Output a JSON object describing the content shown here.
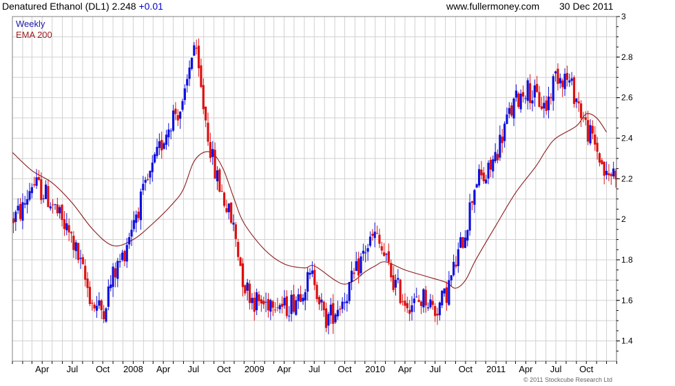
{
  "header": {
    "title": "Denatured Ethanol (DL1) 2.248",
    "change": "+0.01",
    "site": "www.fullermoney.com",
    "date": "30 Dec 2011"
  },
  "legend": {
    "weekly": "Weekly",
    "ema": "EMA 200"
  },
  "copyright": "© 2011 Stockcube Research Ltd",
  "colors": {
    "up": "#1010dd",
    "down": "#dd1010",
    "ema": "#8b1a1a",
    "grid": "#d0d0d0",
    "frame": "#808080"
  },
  "chart_data": {
    "type": "candlestick",
    "frequency": "weekly",
    "x_range": [
      "2007-01",
      "2011-12"
    ],
    "ylim": [
      1.3,
      3.0
    ],
    "yticks": [
      1.4,
      1.6,
      1.8,
      2,
      2.2,
      2.4,
      2.6,
      2.8,
      3
    ],
    "ytick_labels": [
      "1.4",
      "1.6",
      "1.8",
      "2",
      "2.2",
      "2.4",
      "2.6",
      "2.8",
      "3"
    ],
    "xticks": [
      {
        "label": "Apr",
        "date": "2007-04"
      },
      {
        "label": "Jul",
        "date": "2007-07"
      },
      {
        "label": "Oct",
        "date": "2007-10"
      },
      {
        "label": "2008",
        "date": "2008-01"
      },
      {
        "label": "Apr",
        "date": "2008-04"
      },
      {
        "label": "Jul",
        "date": "2008-07"
      },
      {
        "label": "Oct",
        "date": "2008-10"
      },
      {
        "label": "2009",
        "date": "2009-01"
      },
      {
        "label": "Apr",
        "date": "2009-04"
      },
      {
        "label": "Jul",
        "date": "2009-07"
      },
      {
        "label": "Oct",
        "date": "2009-10"
      },
      {
        "label": "2010",
        "date": "2010-01"
      },
      {
        "label": "Apr",
        "date": "2010-04"
      },
      {
        "label": "Jul",
        "date": "2010-07"
      },
      {
        "label": "Oct",
        "date": "2010-10"
      },
      {
        "label": "2011",
        "date": "2011-01"
      },
      {
        "label": "Apr",
        "date": "2011-04"
      },
      {
        "label": "Jul",
        "date": "2011-07"
      },
      {
        "label": "Oct",
        "date": "2011-10"
      }
    ],
    "price_path": [
      [
        "2007-01",
        2.0
      ],
      [
        "2007-02",
        2.05
      ],
      [
        "2007-03",
        2.18
      ],
      [
        "2007-04",
        2.14
      ],
      [
        "2007-05",
        2.08
      ],
      [
        "2007-06",
        1.98
      ],
      [
        "2007-07",
        1.9
      ],
      [
        "2007-08",
        1.74
      ],
      [
        "2007-09",
        1.58
      ],
      [
        "2007-10",
        1.55
      ],
      [
        "2007-11",
        1.72
      ],
      [
        "2007-12",
        1.82
      ],
      [
        "2008-01",
        2.0
      ],
      [
        "2008-02",
        2.12
      ],
      [
        "2008-03",
        2.25
      ],
      [
        "2008-04",
        2.4
      ],
      [
        "2008-05",
        2.52
      ],
      [
        "2008-06",
        2.55
      ],
      [
        "2008-07",
        2.88
      ],
      [
        "2008-08",
        2.55
      ],
      [
        "2008-09",
        2.25
      ],
      [
        "2008-10",
        2.1
      ],
      [
        "2008-11",
        1.95
      ],
      [
        "2008-12",
        1.68
      ],
      [
        "2009-01",
        1.6
      ],
      [
        "2009-02",
        1.58
      ],
      [
        "2009-03",
        1.62
      ],
      [
        "2009-04",
        1.56
      ],
      [
        "2009-05",
        1.6
      ],
      [
        "2009-06",
        1.68
      ],
      [
        "2009-07",
        1.72
      ],
      [
        "2009-08",
        1.5
      ],
      [
        "2009-09",
        1.55
      ],
      [
        "2009-10",
        1.62
      ],
      [
        "2009-11",
        1.72
      ],
      [
        "2009-12",
        1.85
      ],
      [
        "2010-01",
        1.92
      ],
      [
        "2010-02",
        1.8
      ],
      [
        "2010-03",
        1.68
      ],
      [
        "2010-04",
        1.6
      ],
      [
        "2010-05",
        1.58
      ],
      [
        "2010-06",
        1.62
      ],
      [
        "2010-07",
        1.55
      ],
      [
        "2010-08",
        1.62
      ],
      [
        "2010-09",
        1.78
      ],
      [
        "2010-10",
        1.95
      ],
      [
        "2010-11",
        2.2
      ],
      [
        "2010-12",
        2.2
      ],
      [
        "2011-01",
        2.32
      ],
      [
        "2011-02",
        2.48
      ],
      [
        "2011-03",
        2.58
      ],
      [
        "2011-04",
        2.65
      ],
      [
        "2011-05",
        2.6
      ],
      [
        "2011-06",
        2.55
      ],
      [
        "2011-07",
        2.72
      ],
      [
        "2011-08",
        2.7
      ],
      [
        "2011-09",
        2.6
      ],
      [
        "2011-10",
        2.45
      ],
      [
        "2011-11",
        2.35
      ],
      [
        "2011-12",
        2.2
      ],
      [
        "2011-12-30",
        2.248
      ]
    ],
    "ema_200": [
      [
        "2007-01",
        2.33
      ],
      [
        "2007-03",
        2.24
      ],
      [
        "2007-05",
        2.18
      ],
      [
        "2007-07",
        2.08
      ],
      [
        "2007-09",
        1.95
      ],
      [
        "2007-11",
        1.87
      ],
      [
        "2008-01",
        1.9
      ],
      [
        "2008-03",
        1.98
      ],
      [
        "2008-05",
        2.08
      ],
      [
        "2008-06",
        2.15
      ],
      [
        "2008-07",
        2.28
      ],
      [
        "2008-08",
        2.33
      ],
      [
        "2008-09",
        2.32
      ],
      [
        "2008-10",
        2.24
      ],
      [
        "2008-11",
        2.1
      ],
      [
        "2008-12",
        1.98
      ],
      [
        "2009-02",
        1.85
      ],
      [
        "2009-04",
        1.78
      ],
      [
        "2009-06",
        1.76
      ],
      [
        "2009-07",
        1.77
      ],
      [
        "2009-09",
        1.7
      ],
      [
        "2009-10",
        1.68
      ],
      [
        "2009-11",
        1.7
      ],
      [
        "2009-12",
        1.74
      ],
      [
        "2010-01",
        1.77
      ],
      [
        "2010-02",
        1.79
      ],
      [
        "2010-04",
        1.75
      ],
      [
        "2010-06",
        1.72
      ],
      [
        "2010-08",
        1.69
      ],
      [
        "2010-09",
        1.66
      ],
      [
        "2010-10",
        1.7
      ],
      [
        "2010-11",
        1.8
      ],
      [
        "2011-01",
        1.97
      ],
      [
        "2011-03",
        2.13
      ],
      [
        "2011-05",
        2.26
      ],
      [
        "2011-06",
        2.34
      ],
      [
        "2011-07",
        2.4
      ],
      [
        "2011-09",
        2.46
      ],
      [
        "2011-10",
        2.52
      ],
      [
        "2011-11",
        2.5
      ],
      [
        "2011-12",
        2.43
      ]
    ]
  }
}
